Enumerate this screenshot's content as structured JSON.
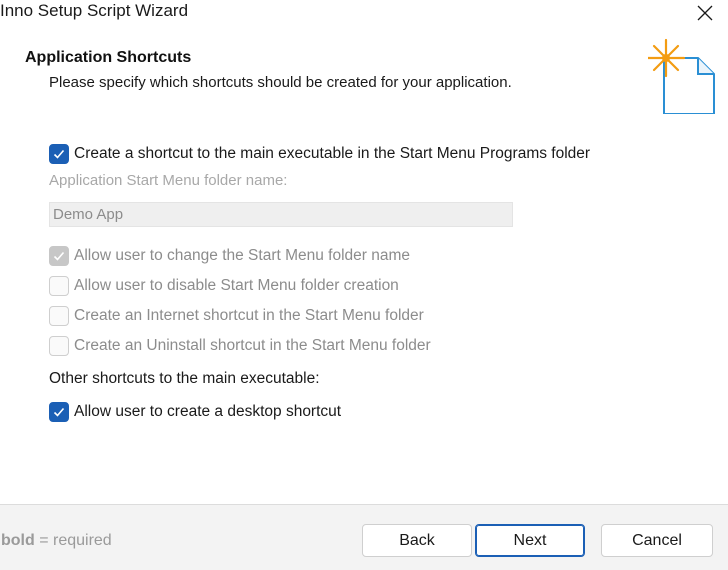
{
  "window": {
    "title": "Inno Setup Script Wizard",
    "close_icon": "close-icon"
  },
  "header": {
    "title": "Application Shortcuts",
    "subtitle": "Please specify which shortcuts should be created for your application.",
    "icon": "document-sparkle-icon",
    "accent_color": "#f39c12"
  },
  "content": {
    "main_shortcut": {
      "label": "Create a shortcut to the main executable in the Start Menu Programs folder",
      "checked": true,
      "enabled": true
    },
    "folder_name": {
      "label": "Application Start Menu folder name:",
      "value": "Demo App",
      "enabled": false
    },
    "options": [
      {
        "label": "Allow user to change the Start Menu folder name",
        "checked": true,
        "enabled": false
      },
      {
        "label": "Allow user to disable Start Menu folder creation",
        "checked": false,
        "enabled": false
      },
      {
        "label": "Create an Internet shortcut in the Start Menu folder",
        "checked": false,
        "enabled": false
      },
      {
        "label": "Create an Uninstall shortcut in the Start Menu folder",
        "checked": false,
        "enabled": false
      }
    ],
    "other_label": "Other shortcuts to the main executable:",
    "desktop_shortcut": {
      "label": "Allow user to create a desktop shortcut",
      "checked": true,
      "enabled": true
    }
  },
  "footer": {
    "note_bold": "bold",
    "note_rest": " = required",
    "back_label": "Back",
    "next_label": "Next",
    "cancel_label": "Cancel"
  },
  "colors": {
    "accent_blue": "#1b5fb5",
    "disabled_check": "#c7c7c7",
    "footer_bg": "#f3f3f3"
  }
}
